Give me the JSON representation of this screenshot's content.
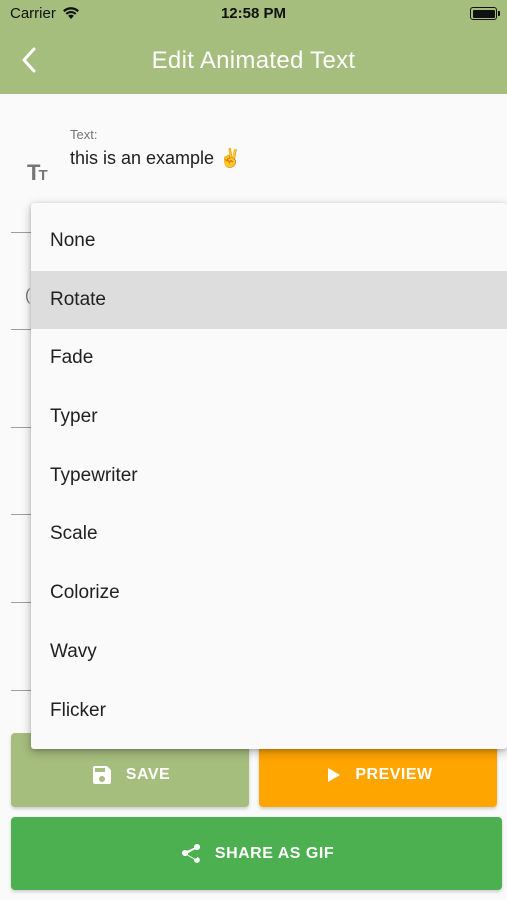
{
  "status_bar": {
    "carrier": "Carrier",
    "time": "12:58 PM",
    "wifi_icon": "wifi-icon",
    "battery_icon": "battery-icon"
  },
  "app_bar": {
    "title": "Edit Animated Text",
    "back_icon": "chevron-left-icon",
    "color": "#a5bd7d"
  },
  "text_field": {
    "label": "Text:",
    "value": "this is an example ✌️",
    "icon": "text-size-icon"
  },
  "dropdown": {
    "items": [
      "None",
      "Rotate",
      "Fade",
      "Typer",
      "Typewriter",
      "Scale",
      "Colorize",
      "Wavy",
      "Flicker"
    ],
    "highlighted": "Rotate"
  },
  "buttons": {
    "save": {
      "label": "SAVE",
      "icon": "save-icon",
      "color": "#a5bd7d"
    },
    "preview": {
      "label": "PREVIEW",
      "icon": "play-icon",
      "color": "#ffa500"
    },
    "share": {
      "label": "SHARE AS GIF",
      "icon": "share-icon",
      "color": "#4caf50"
    }
  }
}
